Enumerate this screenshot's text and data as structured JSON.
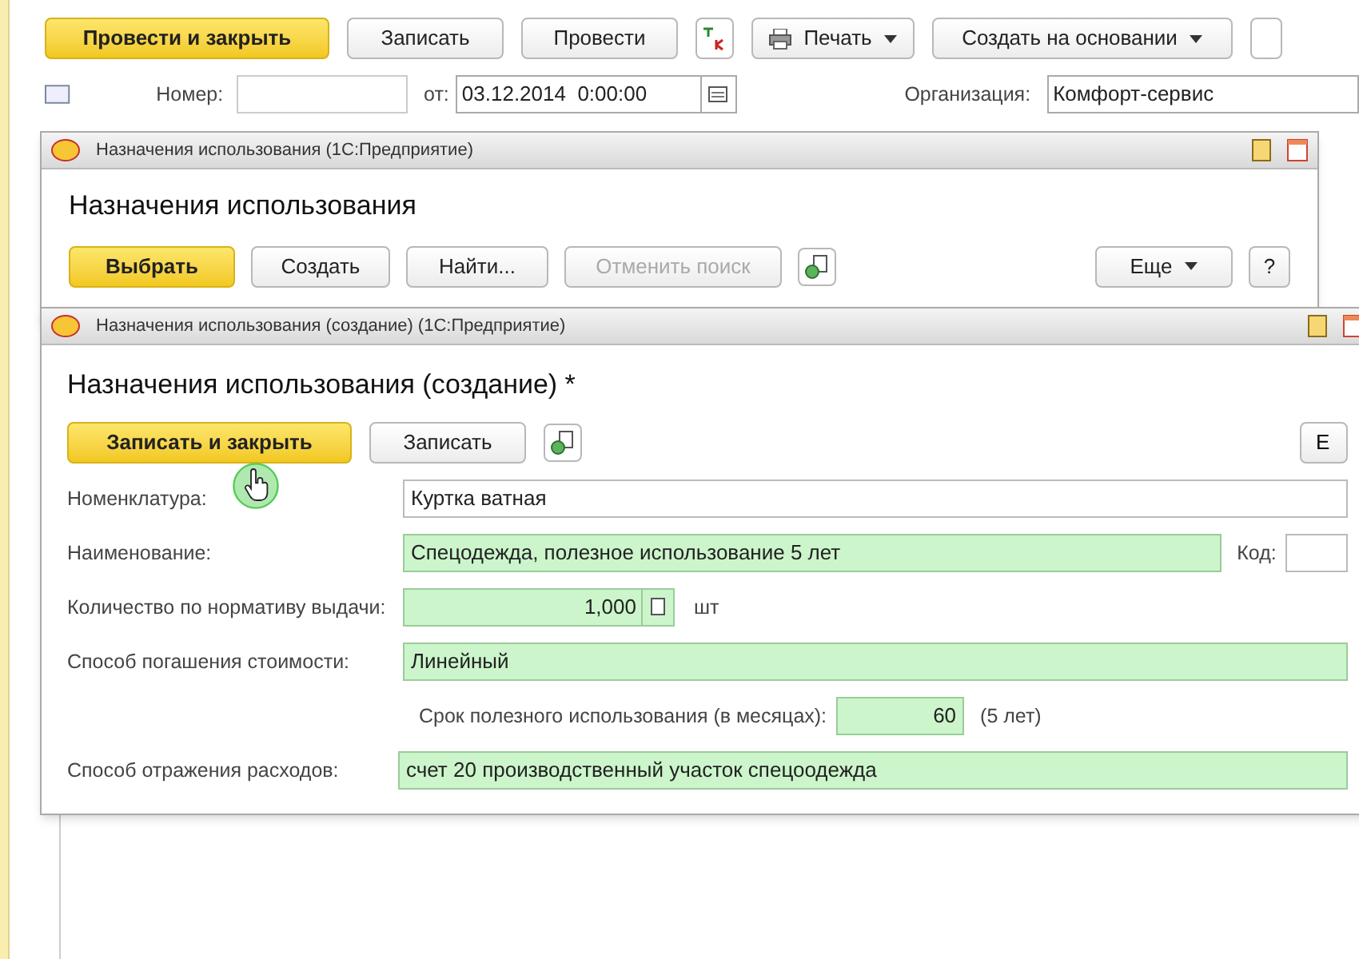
{
  "document": {
    "toolbar": [
      {
        "label": "Провести и закрыть",
        "kind": "default"
      },
      {
        "label": "Записать",
        "kind": "plain"
      },
      {
        "label": "Провести",
        "kind": "plain"
      },
      {
        "kind": "dtkt"
      },
      {
        "label": "Печать",
        "kind": "print"
      },
      {
        "label": "Создать на основании",
        "kind": "menu"
      }
    ],
    "number_label": "Номер:",
    "date_label": "от:",
    "date_value": "03.12.2014  0:00:00",
    "org_label": "Организация:",
    "org_value": "Комфорт-сервис"
  },
  "list_window": {
    "title": "Назначения использования  (1С:Предприятие)",
    "heading": "Назначения использования",
    "buttons": [
      {
        "label": "Выбрать",
        "kind": "default",
        "disabled": false
      },
      {
        "label": "Создать",
        "kind": "plain",
        "disabled": false
      },
      {
        "label": "Найти...",
        "kind": "plain",
        "disabled": false
      },
      {
        "label": "Отменить поиск",
        "kind": "plain",
        "disabled": true
      }
    ],
    "more": "Еще",
    "help": "?"
  },
  "form_window": {
    "title": "Назначения использования (создание)  (1С:Предприятие)",
    "heading": "Назначения использования (создание) *",
    "buttons": [
      {
        "label": "Записать и закрыть",
        "kind": "default"
      },
      {
        "label": "Записать",
        "kind": "plain"
      }
    ],
    "cut_button": "Е",
    "nomenclature": {
      "label": "Номенклатура:",
      "value": "Куртка ватная",
      "highlighted": false
    },
    "name": {
      "label": "Наименование:",
      "value": "Спецодежда, полезное использование 5 лет",
      "highlighted": true
    },
    "code_label": "Код:",
    "quantity": {
      "label": "Количество по нормативу выдачи:",
      "value": "1,000",
      "unit": "шт",
      "highlighted": true
    },
    "method": {
      "label": "Способ погашения стоимости:",
      "value": "Линейный",
      "highlighted": true
    },
    "term": {
      "label": "Срок полезного использования (в месяцах):",
      "value": "60",
      "note": "(5 лет)",
      "highlighted": true
    },
    "expense": {
      "label": "Способ отражения расходов:",
      "value": "счет 20 производственный участок спецоодежда",
      "highlighted": true
    }
  }
}
